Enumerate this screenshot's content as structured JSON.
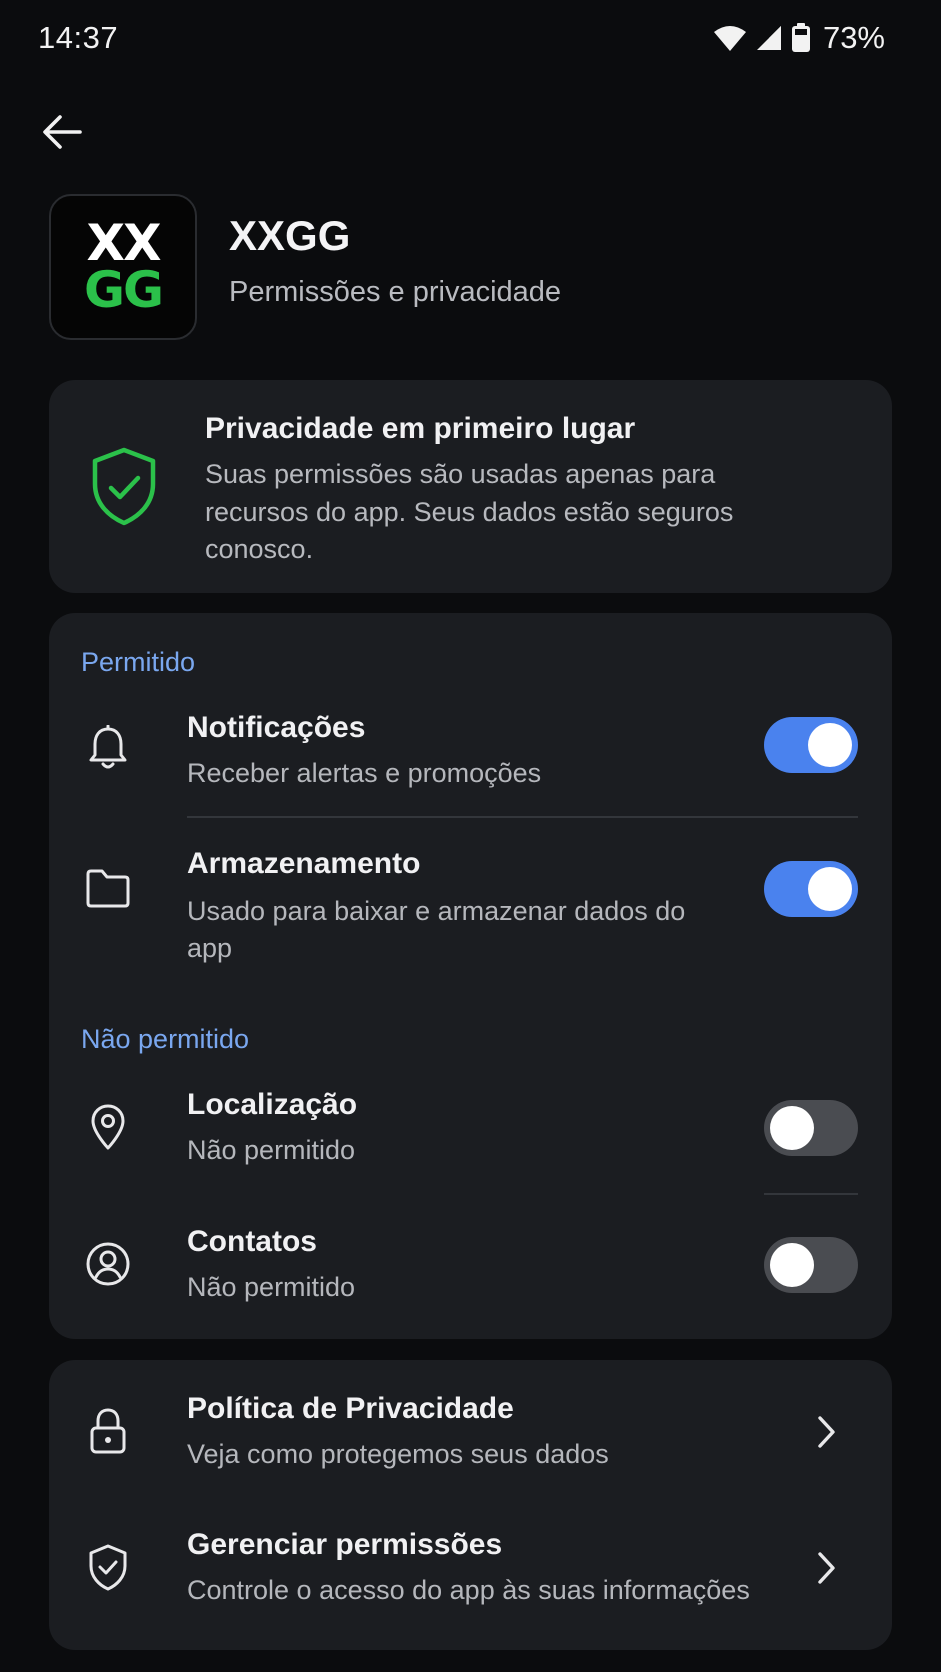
{
  "status_bar": {
    "time": "14:37",
    "battery": "73%",
    "icons": [
      "wifi-icon",
      "signal-icon",
      "battery-icon"
    ]
  },
  "header": {
    "back_icon": "arrow-left-icon",
    "app_icon_line1": "XX",
    "app_icon_line2": "GG",
    "app_name": "XXGG",
    "subtitle": "Permissões e privacidade"
  },
  "privacy_card": {
    "icon": "shield-check-icon",
    "title": "Privacidade em primeiro lugar",
    "body": "Suas permissões são usadas apenas para recursos do app. Seus dados estão seguros conosco."
  },
  "permissions": {
    "allowed_label": "Permitido",
    "denied_label": "Não permitido",
    "allowed": [
      {
        "icon": "bell-icon",
        "title": "Notificações",
        "subtitle": "Receber alertas e promoções",
        "enabled": true
      },
      {
        "icon": "folder-icon",
        "title": "Armazenamento",
        "subtitle": "Usado para baixar e armazenar dados do app",
        "enabled": true
      }
    ],
    "denied": [
      {
        "icon": "location-pin-icon",
        "title": "Localização",
        "subtitle": "Não permitido",
        "enabled": false
      },
      {
        "icon": "contact-icon",
        "title": "Contatos",
        "subtitle": "Não permitido",
        "enabled": false
      }
    ]
  },
  "links": [
    {
      "icon": "lock-icon",
      "title": "Política de Privacidade",
      "subtitle": "Veja como protegemos seus dados"
    },
    {
      "icon": "shield-check-icon",
      "title": "Gerenciar permissões",
      "subtitle": "Controle o acesso do app às suas informações"
    }
  ],
  "colors": {
    "background": "#0b0c0e",
    "card": "#1b1d21",
    "accent_blue": "#4a82ee",
    "section_label": "#7aa7ef",
    "brand_green": "#2bc14a"
  }
}
